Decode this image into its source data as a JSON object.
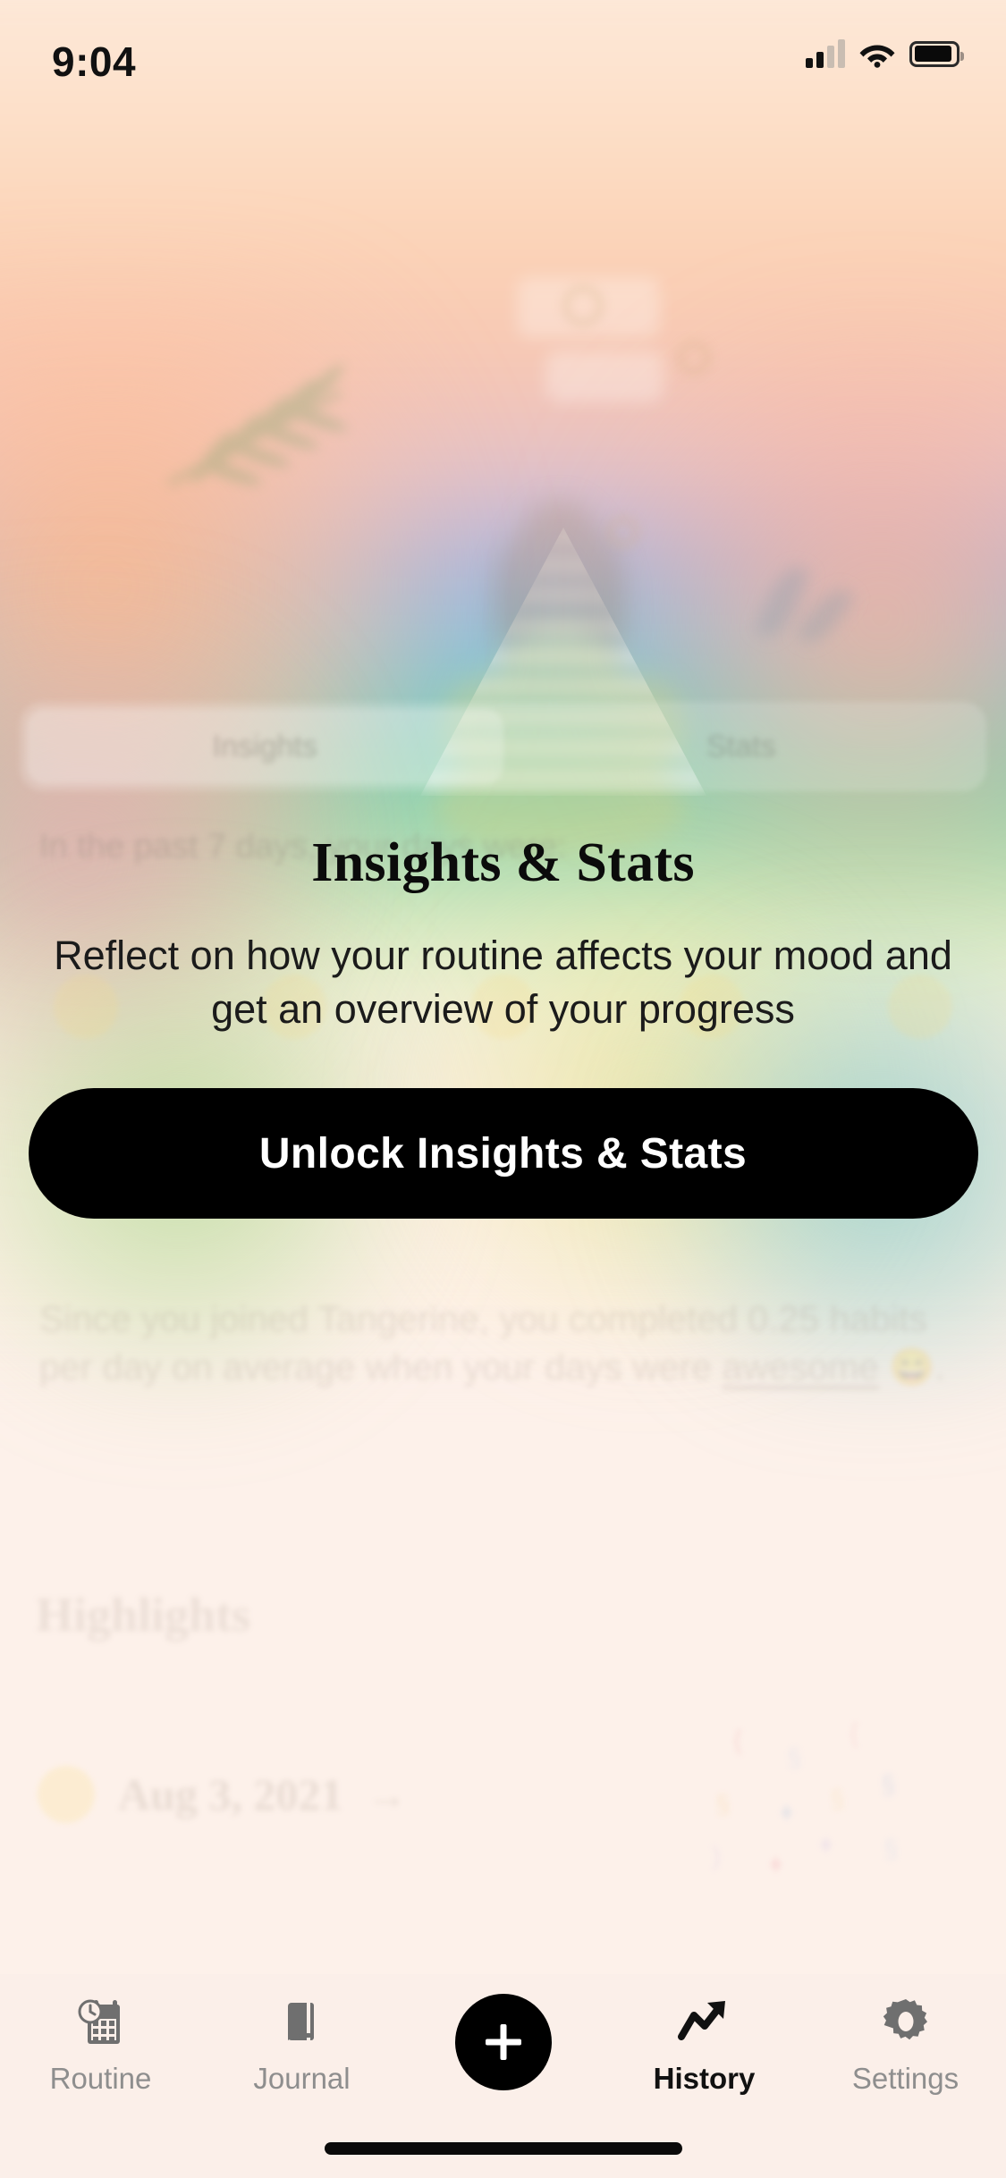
{
  "status_bar": {
    "time": "9:04",
    "signal_icon": "cellular-signal-icon",
    "wifi_icon": "wifi-icon",
    "battery_icon": "battery-icon"
  },
  "locked_content": {
    "segmented": {
      "options": [
        "Insights",
        "Stats"
      ],
      "selected": "Insights"
    },
    "insight_line": "In the past 7 days, your days were:",
    "summary_prefix": "Since you joined Tangerine, you completed 0.25 habits per day on average when your days were ",
    "summary_link": "awesome",
    "summary_emoji": "😄",
    "summary_suffix": ".",
    "highlights_heading": "Highlights",
    "highlight_date": "Aug 3, 2021",
    "highlight_arrow": "→",
    "highlight_emoji": "🙂"
  },
  "paywall": {
    "title": "Insights & Stats",
    "subtitle": "Reflect on how your routine affects your mood and get an overview of your progress",
    "button_label": "Unlock Insights & Stats",
    "button_color": "#000000",
    "button_text_color": "#ffffff"
  },
  "tab_bar": {
    "items": [
      {
        "label": "Routine",
        "icon": "calendar-clock-icon",
        "active": false
      },
      {
        "label": "Journal",
        "icon": "book-icon",
        "active": false
      },
      {
        "label": "",
        "icon": "plus-icon",
        "active": false
      },
      {
        "label": "History",
        "icon": "trending-up-icon",
        "active": true
      },
      {
        "label": "Settings",
        "icon": "gear-icon",
        "active": false
      }
    ]
  },
  "theme": {
    "background": "#fdf1ea",
    "tabbar_background": "#fbefe9",
    "active_color": "#111111",
    "inactive_color": "#8e8e8e"
  }
}
